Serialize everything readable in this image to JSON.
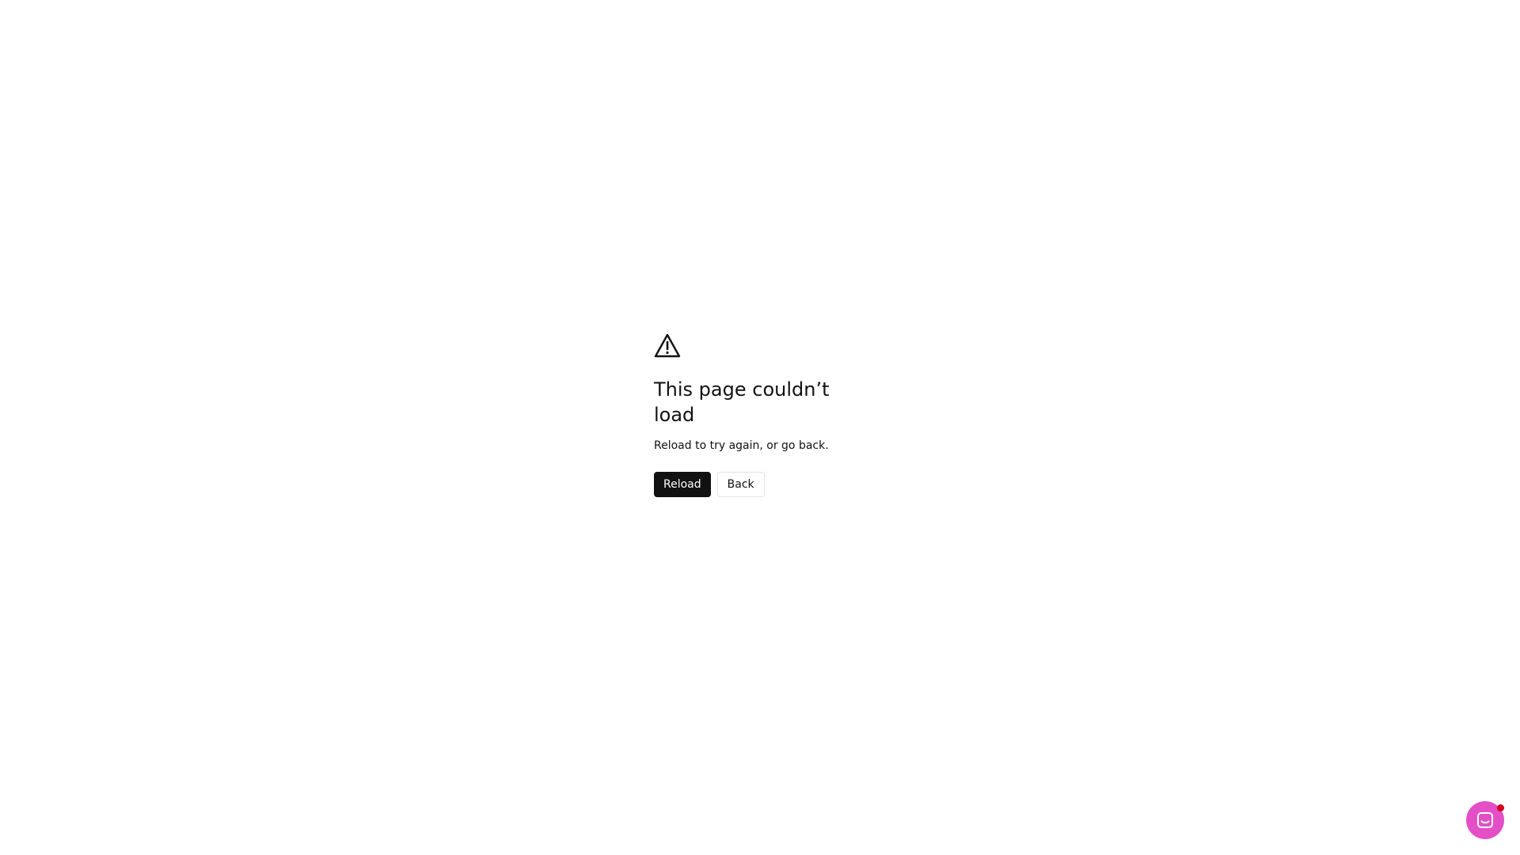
{
  "error": {
    "icon": "warning-triangle-icon",
    "title": "This page couldn’t load",
    "message": "Reload to try again, or go back.",
    "reload_label": "Reload",
    "back_label": "Back"
  },
  "chat_launcher": {
    "icon": "chat-bubble-icon",
    "color": "#e44fc8",
    "notification_dot_color": "#d0021b"
  },
  "colors": {
    "primary_button_bg": "#111111",
    "primary_button_text": "#ffffff",
    "secondary_button_border": "#e3e3e3",
    "background": "#ffffff"
  }
}
